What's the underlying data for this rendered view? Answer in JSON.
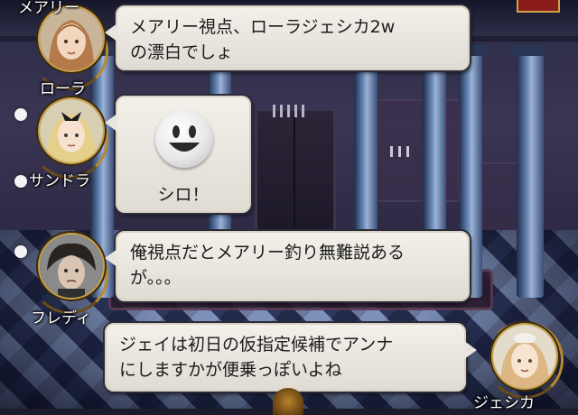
{
  "game": {
    "messages": [
      {
        "speaker": "メアリー",
        "speaker_display": "メアリー",
        "text_lines": [
          "メアリー視点、ローラジェシカ2w",
          "の漂白でしょ"
        ]
      },
      {
        "speaker": "ローラ"
      },
      {
        "speaker": "サンドラ",
        "stamp": "smiley-face",
        "text": "シロ！"
      },
      {
        "speaker": "フレディ",
        "text_lines": [
          "俺視点だとメアリー釣り無難説ある",
          "が。。。"
        ]
      },
      {
        "speaker": "ジェシカ",
        "text_lines": [
          "ジェイは初日の仮指定候補でアンナ",
          "にしますかが便乗っぽいよね"
        ]
      }
    ],
    "labels": {
      "top_partial": "メアリー",
      "laura": "ローラ",
      "sandra": "サンドラ",
      "freddie": "フレディ",
      "jessica": "ジェシカ"
    },
    "colors": {
      "bubble_bg": "#ece8e1",
      "frame_gold": "#c9a24a",
      "name_text": "#ffffff"
    }
  }
}
